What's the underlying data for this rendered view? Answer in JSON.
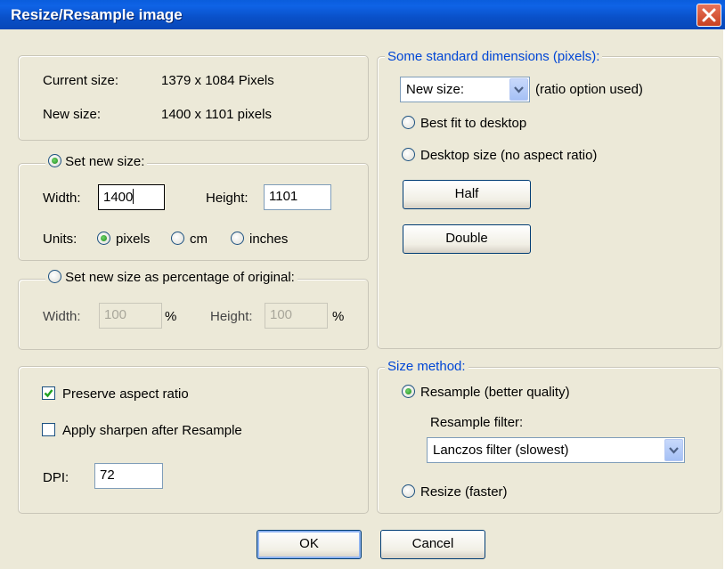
{
  "window": {
    "title": "Resize/Resample image"
  },
  "current": {
    "label": "Current size:",
    "value": "1379  x  1084  Pixels"
  },
  "newsize": {
    "label": "New size:",
    "value": "1400  x  1101  pixels"
  },
  "set_new_size": {
    "label": "Set new size:",
    "width_label": "Width:",
    "width_value": "1400",
    "height_label": "Height:",
    "height_value": "1101",
    "units_label": "Units:",
    "units": [
      "pixels",
      "cm",
      "inches"
    ],
    "selected_unit": "pixels"
  },
  "percentage": {
    "label": "Set new size as percentage of original:",
    "width_label": "Width:",
    "width_value": "100",
    "width_unit": "%",
    "height_label": "Height:",
    "height_value": "100",
    "height_unit": "%"
  },
  "standard": {
    "legend": "Some standard dimensions (pixels):",
    "select_value": "New size:",
    "ratio_note": "(ratio option used)",
    "best_fit": "Best fit to desktop",
    "desktop_size": "Desktop size (no aspect ratio)",
    "half": "Half",
    "double": "Double"
  },
  "options": {
    "preserve": "Preserve aspect ratio",
    "preserve_checked": true,
    "sharpen": "Apply sharpen after Resample",
    "sharpen_checked": false,
    "dpi_label": "DPI:",
    "dpi_value": "72"
  },
  "method": {
    "legend": "Size method:",
    "resample": "Resample (better quality)",
    "filter_label": "Resample filter:",
    "filter_value": "Lanczos filter (slowest)",
    "resize": "Resize (faster)",
    "selected": "resample"
  },
  "buttons": {
    "ok": "OK",
    "cancel": "Cancel"
  },
  "colors": {
    "title_bar": "#0950c8",
    "dialog_bg": "#ece9d8",
    "legend_blue": "#0046d5",
    "close_red": "#d9532f"
  }
}
